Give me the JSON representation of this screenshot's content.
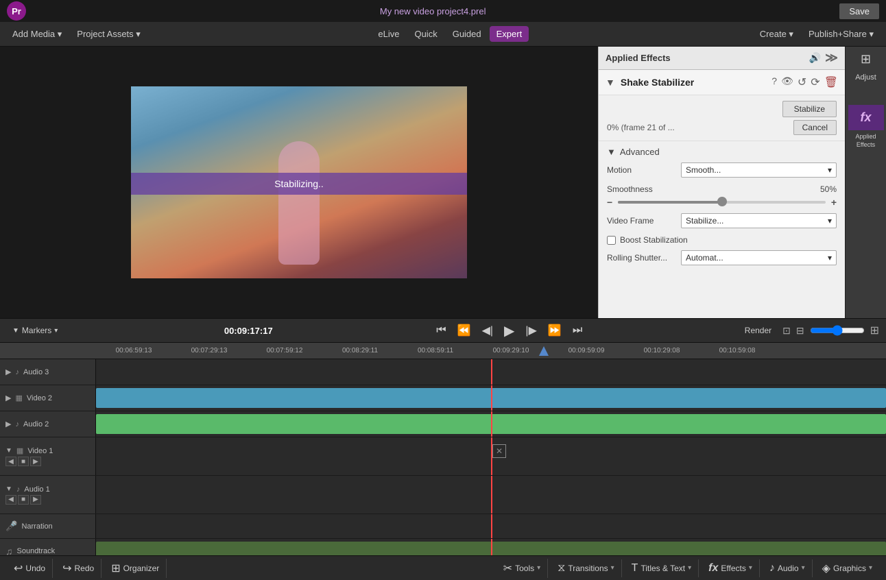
{
  "titlebar": {
    "project_name": "My new video project4.prel",
    "save_label": "Save",
    "logo_text": "Pr"
  },
  "menubar": {
    "items": [
      {
        "id": "add-media",
        "label": "Add Media",
        "has_arrow": true
      },
      {
        "id": "project-assets",
        "label": "Project Assets",
        "has_arrow": true
      },
      {
        "id": "elive",
        "label": "eLive"
      },
      {
        "id": "quick",
        "label": "Quick"
      },
      {
        "id": "guided",
        "label": "Guided"
      },
      {
        "id": "expert",
        "label": "Expert",
        "active": true
      }
    ],
    "right_items": [
      {
        "id": "create",
        "label": "Create",
        "has_arrow": true
      },
      {
        "id": "publish-share",
        "label": "Publish+Share",
        "has_arrow": true
      }
    ]
  },
  "effects_panel": {
    "title": "Applied Effects",
    "effect_name": "Shake Stabilizer",
    "stabilize_btn": "Stabilize",
    "cancel_btn": "Cancel",
    "progress_text": "0% (frame 21 of ...",
    "advanced_label": "Advanced",
    "motion_label": "Motion",
    "motion_value": "Smooth...",
    "smoothness_label": "Smoothness",
    "smoothness_value": "50",
    "smoothness_percent": "%",
    "video_frame_label": "Video Frame",
    "video_frame_value": "Stabilize...",
    "boost_label": "Boost Stabilization",
    "rolling_shutter_label": "Rolling Shutter...",
    "rolling_shutter_value": "Automat..."
  },
  "adjust_panel": {
    "adjust_label": "Adjust",
    "fx_label": "Applied\nEffects",
    "fx_symbol": "fx"
  },
  "timeline": {
    "current_time": "00:09:17:17",
    "render_label": "Render",
    "ruler_times": [
      "00:06:59:13",
      "00:07:29:13",
      "00:07:59:12",
      "00:08:29:11",
      "00:08:59:11",
      "00:09:29:10",
      "00:09:59:09",
      "00:10:29:08",
      "00:10:59:08"
    ],
    "tracks": [
      {
        "id": "audio3",
        "label": "Audio 3",
        "type": "audio",
        "has_clip": false
      },
      {
        "id": "video2",
        "label": "Video 2",
        "type": "video",
        "has_clip": true,
        "clip_color": "blue"
      },
      {
        "id": "audio2",
        "label": "Audio 2",
        "type": "audio",
        "has_clip": true,
        "clip_color": "green"
      },
      {
        "id": "video1",
        "label": "Video 1",
        "type": "video",
        "has_clip": false,
        "tall": true
      },
      {
        "id": "audio1",
        "label": "Audio 1",
        "type": "audio",
        "has_clip": false,
        "tall": true
      },
      {
        "id": "narration",
        "label": "Narration",
        "type": "narration",
        "has_clip": false
      },
      {
        "id": "soundtrack",
        "label": "Soundtrack",
        "type": "soundtrack",
        "has_clip": true,
        "clip_color": "green-dark"
      }
    ]
  },
  "bottom_toolbar": {
    "items": [
      {
        "id": "undo",
        "label": "Undo",
        "icon": "↩"
      },
      {
        "id": "redo",
        "label": "Redo",
        "icon": "↪"
      },
      {
        "id": "organizer",
        "label": "Organizer",
        "icon": "⊞"
      },
      {
        "id": "tools",
        "label": "Tools",
        "icon": "✂",
        "has_arrow": true
      },
      {
        "id": "transitions",
        "label": "Transitions",
        "icon": "⧖",
        "has_arrow": true
      },
      {
        "id": "titles-text",
        "label": "Titles & Text",
        "icon": "T",
        "has_arrow": true
      },
      {
        "id": "effects",
        "label": "Effects",
        "icon": "fx",
        "has_arrow": true
      },
      {
        "id": "audio",
        "label": "Audio",
        "icon": "♪",
        "has_arrow": true
      },
      {
        "id": "graphics",
        "label": "Graphics",
        "icon": "◈",
        "has_arrow": true
      }
    ]
  },
  "preview": {
    "stabilizing_text": "Stabilizing.."
  },
  "markers": {
    "label": "Markers",
    "has_arrow": true
  }
}
